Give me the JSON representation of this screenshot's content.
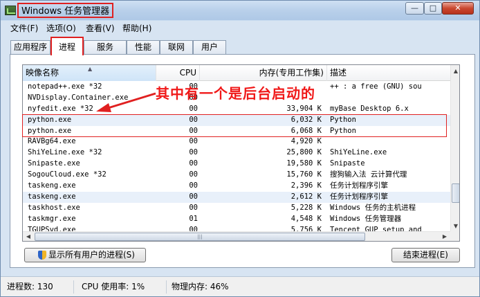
{
  "window": {
    "title": "Windows 任务管理器",
    "min": "—",
    "max": "□",
    "close": "✕"
  },
  "menu": [
    "文件(F)",
    "选项(O)",
    "查看(V)",
    "帮助(H)"
  ],
  "tabs": [
    "应用程序",
    "进程",
    "服务",
    "性能",
    "联网",
    "用户"
  ],
  "columns": {
    "name": "映像名称",
    "cpu": "CPU",
    "mem": "内存(专用工作集)",
    "desc": "描述"
  },
  "processes": [
    {
      "name": "notepad++.exe *32",
      "cpu": "00",
      "mem": "",
      "desc": "++ : a free (GNU) sou"
    },
    {
      "name": "NVDisplay.Container.exe",
      "cpu": "00",
      "mem": "",
      "desc": ""
    },
    {
      "name": "nyfedit.exe *32",
      "cpu": "00",
      "mem": "33,904 K",
      "desc": "myBase Desktop 6.x"
    },
    {
      "name": "python.exe",
      "cpu": "00",
      "mem": "6,032 K",
      "desc": "Python"
    },
    {
      "name": "python.exe",
      "cpu": "00",
      "mem": "6,068 K",
      "desc": "Python"
    },
    {
      "name": "RAVBg64.exe",
      "cpu": "00",
      "mem": "4,920 K",
      "desc": ""
    },
    {
      "name": "ShiYeLine.exe *32",
      "cpu": "00",
      "mem": "25,800 K",
      "desc": "ShiYeLine.exe"
    },
    {
      "name": "Snipaste.exe",
      "cpu": "00",
      "mem": "19,580 K",
      "desc": "Snipaste"
    },
    {
      "name": "SogouCloud.exe *32",
      "cpu": "00",
      "mem": "15,760 K",
      "desc": "搜狗输入法 云计算代理"
    },
    {
      "name": "taskeng.exe",
      "cpu": "00",
      "mem": "2,396 K",
      "desc": "任务计划程序引擎"
    },
    {
      "name": "taskeng.exe",
      "cpu": "00",
      "mem": "2,612 K",
      "desc": "任务计划程序引擎"
    },
    {
      "name": "taskhost.exe",
      "cpu": "00",
      "mem": "5,228 K",
      "desc": "Windows 任务的主机进程"
    },
    {
      "name": "taskmgr.exe",
      "cpu": "01",
      "mem": "4,548 K",
      "desc": "Windows 任务管理器"
    },
    {
      "name": "TGUPSvd.exe",
      "cpu": "00",
      "mem": "5,756 K",
      "desc": "Tencent GUP setup and"
    }
  ],
  "annotation": "其中有一个是后台启动的",
  "buttons": {
    "show_all": "显示所有用户的进程(S)",
    "end_process": "结束进程(E)"
  },
  "status": {
    "processes": "进程数: 130",
    "cpu": "CPU 使用率: 1%",
    "memory": "物理内存: 46%"
  },
  "icons": {
    "app": "task-manager-icon",
    "shield": "uac-shield-icon"
  },
  "colors": {
    "annotation_red": "#e02020"
  }
}
